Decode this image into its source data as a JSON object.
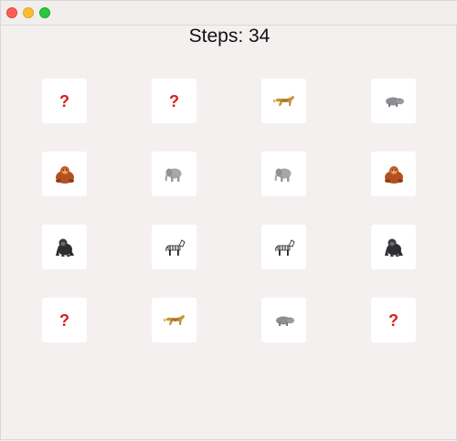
{
  "header": {
    "steps_label": "Steps: 34"
  },
  "board": {
    "hidden_symbol": "?",
    "cards": [
      {
        "state": "hidden",
        "icon": "question-mark"
      },
      {
        "state": "hidden",
        "icon": "question-mark"
      },
      {
        "state": "revealed",
        "icon": "leopard-icon"
      },
      {
        "state": "revealed",
        "icon": "hippo-icon"
      },
      {
        "state": "revealed",
        "icon": "orangutan-icon"
      },
      {
        "state": "revealed",
        "icon": "elephant-icon"
      },
      {
        "state": "revealed",
        "icon": "elephant-icon"
      },
      {
        "state": "revealed",
        "icon": "orangutan-icon"
      },
      {
        "state": "revealed",
        "icon": "gorilla-icon"
      },
      {
        "state": "revealed",
        "icon": "zebra-icon"
      },
      {
        "state": "revealed",
        "icon": "zebra-icon"
      },
      {
        "state": "revealed",
        "icon": "gorilla-icon"
      },
      {
        "state": "hidden",
        "icon": "question-mark"
      },
      {
        "state": "revealed",
        "icon": "leopard-icon"
      },
      {
        "state": "revealed",
        "icon": "hippo-icon"
      },
      {
        "state": "hidden",
        "icon": "question-mark"
      }
    ]
  },
  "colors": {
    "background": "#f4f0f0",
    "card": "#ffffff",
    "hidden_mark": "#d6201e"
  }
}
